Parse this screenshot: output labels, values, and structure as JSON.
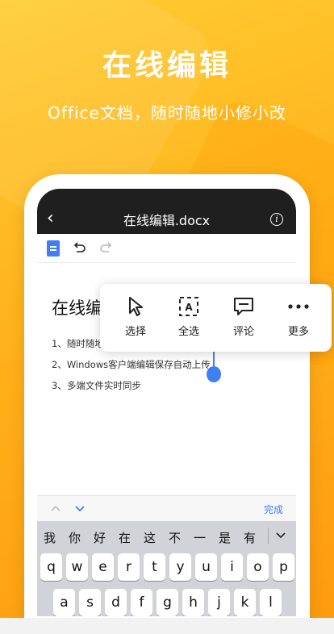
{
  "hero": {
    "title": "在线编辑",
    "subtitle": "Office文档，随时随地小修小改"
  },
  "app": {
    "doc_title": "在线编辑.docx",
    "back_icon": "chevron-left-icon",
    "info_icon": "info-icon"
  },
  "toolbar": {
    "icons": [
      "doc-icon",
      "undo-icon",
      "redo-icon"
    ]
  },
  "document": {
    "heading": "在线编",
    "lines": [
      "1、随时随地",
      "2、Windows客户端编辑保存自动上传",
      "3、多端文件实时同步"
    ]
  },
  "context_menu": {
    "items": [
      {
        "label": "选择",
        "icon": "cursor-icon"
      },
      {
        "label": "全选",
        "icon": "select-all-icon"
      },
      {
        "label": "评论",
        "icon": "comment-icon"
      },
      {
        "label": "更多",
        "icon": "more-icon"
      }
    ]
  },
  "keyboard_bar": {
    "done_label": "完成"
  },
  "keyboard": {
    "candidates": [
      "我",
      "你",
      "好",
      "在",
      "这",
      "不",
      "一",
      "是",
      "有"
    ],
    "row1": [
      "q",
      "w",
      "e",
      "r",
      "t",
      "y",
      "u",
      "i",
      "o",
      "p"
    ],
    "row2": [
      "a",
      "s",
      "d",
      "f",
      "g",
      "h",
      "j",
      "k",
      "l"
    ]
  },
  "colors": {
    "accent": "#3f7ef3",
    "background": "#ffb21a",
    "titlebar": "#1f1f1f"
  }
}
